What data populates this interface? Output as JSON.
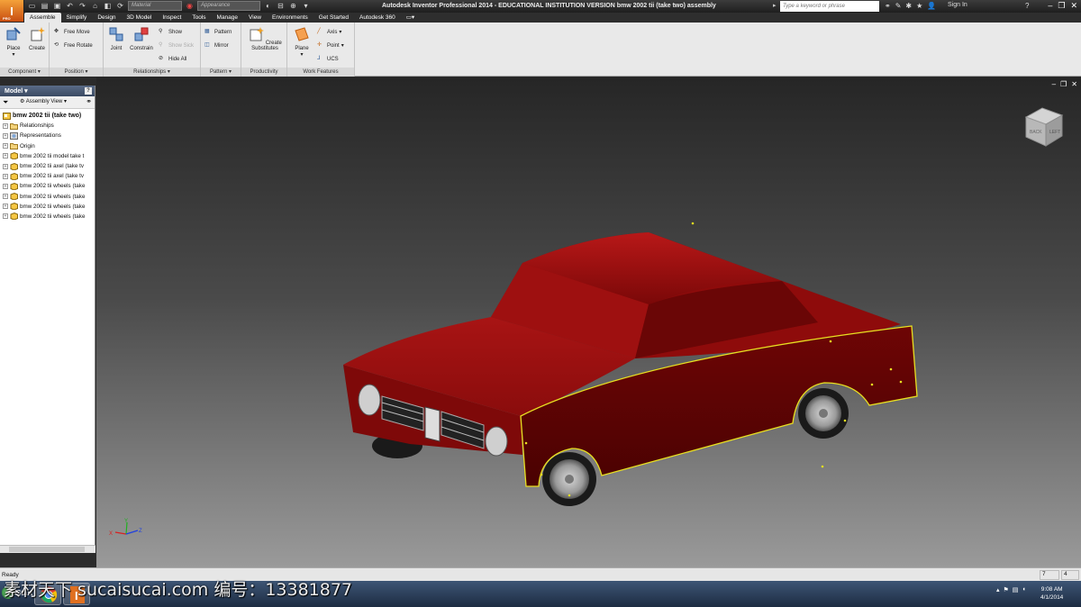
{
  "window": {
    "title": "Autodesk Inventor Professional 2014 - EDUCATIONAL INSTITUTION VERSION    bmw 2002 tii (take two) assembly",
    "app_badge": "PRO",
    "material_placeholder": "Material",
    "appearance_placeholder": "Appearance",
    "search_placeholder": "Type a keyword or phrase",
    "sign_in": "Sign In"
  },
  "tabs": [
    "Assemble",
    "Simplify",
    "Design",
    "3D Model",
    "Inspect",
    "Tools",
    "Manage",
    "View",
    "Environments",
    "Get Started",
    "Autodesk 360"
  ],
  "ribbon": {
    "component": {
      "title": "Component",
      "place": "Place",
      "create": "Create"
    },
    "position": {
      "title": "Position",
      "free_move": "Free Move",
      "free_rotate": "Free Rotate"
    },
    "relationships": {
      "title": "Relationships",
      "joint": "Joint",
      "constrain": "Constrain",
      "show": "Show",
      "show_sick": "Show Sick",
      "hide_all": "Hide All"
    },
    "pattern": {
      "title": "Pattern",
      "pattern": "Pattern",
      "mirror": "Mirror"
    },
    "productivity": {
      "title": "Productivity",
      "create_substitutes_1": "Create",
      "create_substitutes_2": "Substitutes"
    },
    "work_features": {
      "title": "Work Features",
      "plane": "Plane",
      "axis": "Axis",
      "point": "Point",
      "ucs": "UCS"
    }
  },
  "browser": {
    "header": "Model",
    "view": "Assembly View",
    "root": "bmw 2002 tii (take two)",
    "items": [
      "Relationships",
      "Representations",
      "Origin",
      "bmw 2002 tii model take t",
      "bmw 2002 tii axel (take tv",
      "bmw 2002 tii axel (take tv",
      "bmw 2002 tii wheels (take",
      "bmw 2002 tii wheels (take",
      "bmw 2002 tii wheels (take",
      "bmw 2002 tii wheels (take"
    ]
  },
  "viewcube": {
    "back": "BACK",
    "left": "LEFT"
  },
  "triad": {
    "x": "X",
    "y": "Y",
    "z": "Z"
  },
  "status": {
    "text": "Ready",
    "count1": "7",
    "count2": "4"
  },
  "taskbar": {
    "start": "Start",
    "time": "9:08 AM",
    "date": "4/1/2014"
  },
  "watermark": "素材天下 sucaisucai.com  编号：13381877",
  "colors": {
    "car_body": "#8c0d0d",
    "selection": "#e8e020",
    "accent": "#f08a24"
  }
}
